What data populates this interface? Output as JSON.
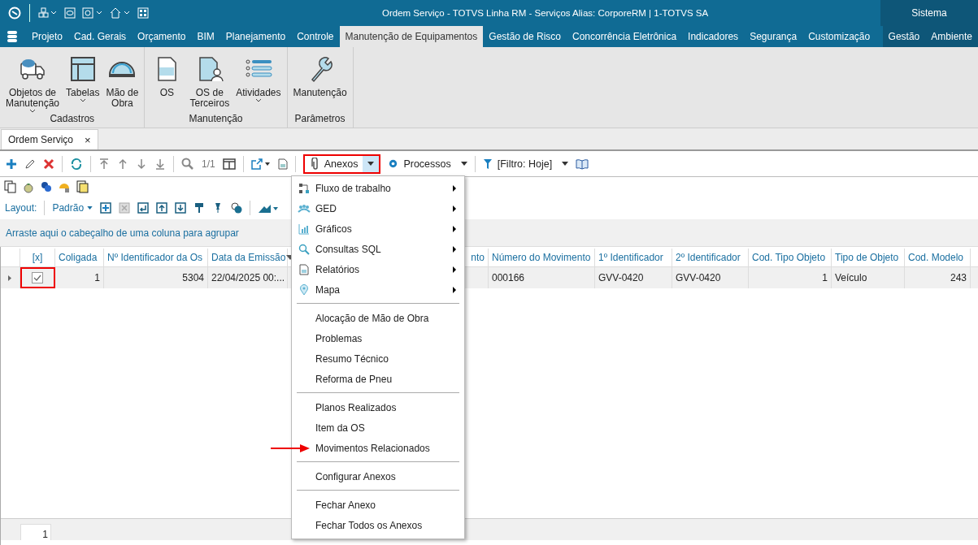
{
  "window": {
    "title": "Ordem Serviço - TOTVS Linha RM - Serviços  Alias: CorporeRM | 1-TOTVS SA",
    "system_label": "Sistema"
  },
  "tabs": [
    {
      "label": "Projeto",
      "selected": false
    },
    {
      "label": "Cad. Gerais",
      "selected": false
    },
    {
      "label": "Orçamento",
      "selected": false
    },
    {
      "label": "BIM",
      "selected": false
    },
    {
      "label": "Planejamento",
      "selected": false
    },
    {
      "label": "Controle",
      "selected": false
    },
    {
      "label": "Manutenção de Equipamentos",
      "selected": true
    },
    {
      "label": "Gestão de Risco",
      "selected": false
    },
    {
      "label": "Concorrência Eletrônica",
      "selected": false
    },
    {
      "label": "Indicadores",
      "selected": false
    },
    {
      "label": "Segurança",
      "selected": false
    },
    {
      "label": "Customização",
      "selected": false
    }
  ],
  "system_tabs": [
    "Gestão",
    "Ambiente"
  ],
  "ribbon": [
    {
      "label": "Cadastros",
      "buttons": [
        {
          "lines": [
            "Objetos de",
            "Manutenção"
          ],
          "dropdown": true
        },
        {
          "lines": [
            "Tabelas"
          ],
          "dropdown": true
        },
        {
          "lines": [
            "Mão de",
            "Obra"
          ],
          "dropdown": false
        }
      ]
    },
    {
      "label": "Manutenção",
      "buttons": [
        {
          "lines": [
            "OS"
          ],
          "dropdown": false
        },
        {
          "lines": [
            "OS de",
            "Terceiros"
          ],
          "dropdown": false
        },
        {
          "lines": [
            "Atividades"
          ],
          "dropdown": true
        }
      ]
    },
    {
      "label": "Parâmetros",
      "buttons": [
        {
          "lines": [
            "Manutenção"
          ],
          "dropdown": false
        }
      ]
    }
  ],
  "document_tab": {
    "label": "Ordem Serviço",
    "close": "×"
  },
  "toolbar": {
    "counter": "1/1",
    "attachments": {
      "label": "Anexos",
      "highlighted": true
    },
    "processes": "Processos",
    "filter": "[Filtro: Hoje]"
  },
  "layout_bar": {
    "label": "Layout:",
    "value": "Padrão"
  },
  "group_panel": "Arraste aqui o cabeçalho de uma coluna para agrupar",
  "table": {
    "columns": [
      {
        "label": "[x]",
        "kind": "check",
        "sorted": false
      },
      {
        "label": "Coligada",
        "kind": "number",
        "sorted": false
      },
      {
        "label": "Nº Identificador da Os",
        "kind": "number",
        "sorted": false
      },
      {
        "label": "Data da Emissão",
        "kind": "text",
        "sorted": true
      },
      {
        "label": "nto",
        "kind": "hidden",
        "sorted": false
      },
      {
        "label": "Número do Movimento",
        "kind": "text",
        "sorted": false
      },
      {
        "label": "1º Identificador",
        "kind": "text",
        "sorted": false
      },
      {
        "label": "2º Identificador",
        "kind": "text",
        "sorted": false
      },
      {
        "label": "Cod. Tipo Objeto",
        "kind": "number",
        "sorted": false
      },
      {
        "label": "Tipo de Objeto",
        "kind": "text",
        "sorted": false
      },
      {
        "label": "Cod. Modelo",
        "kind": "number",
        "sorted": false
      }
    ],
    "rows": [
      {
        "checked": true,
        "highlighted": true,
        "cells": [
          "",
          "1",
          "5304",
          "22/04/2025 00:...",
          "",
          "000166",
          "GVV-0420",
          "GVV-0420",
          "1",
          "Veículo",
          "243"
        ]
      }
    ]
  },
  "pager": {
    "page": "1"
  },
  "menu": {
    "groups": [
      [
        {
          "label": "Fluxo de trabalho",
          "submenu": true,
          "highlighted": false
        },
        {
          "label": "GED",
          "submenu": true,
          "highlighted": false
        },
        {
          "label": "Gráficos",
          "submenu": true,
          "highlighted": false
        },
        {
          "label": "Consultas SQL",
          "submenu": true,
          "highlighted": false
        },
        {
          "label": "Relatórios",
          "submenu": true,
          "highlighted": false
        },
        {
          "label": "Mapa",
          "submenu": true,
          "highlighted": false
        }
      ],
      [
        {
          "label": "Alocação de Mão de Obra",
          "submenu": false,
          "highlighted": false
        },
        {
          "label": "Problemas",
          "submenu": false,
          "highlighted": false
        },
        {
          "label": "Resumo Técnico",
          "submenu": false,
          "highlighted": false
        },
        {
          "label": "Reforma de Pneu",
          "submenu": false,
          "highlighted": false
        }
      ],
      [
        {
          "label": "Planos Realizados",
          "submenu": false,
          "highlighted": false
        },
        {
          "label": "Item da OS",
          "submenu": false,
          "highlighted": false
        },
        {
          "label": "Movimentos Relacionados",
          "submenu": false,
          "highlighted": true
        }
      ],
      [
        {
          "label": "Configurar Anexos",
          "submenu": false,
          "highlighted": false
        }
      ],
      [
        {
          "label": "Fechar Anexo",
          "submenu": false,
          "highlighted": false
        },
        {
          "label": "Fechar Todos os Anexos",
          "submenu": false,
          "highlighted": false
        }
      ]
    ]
  }
}
